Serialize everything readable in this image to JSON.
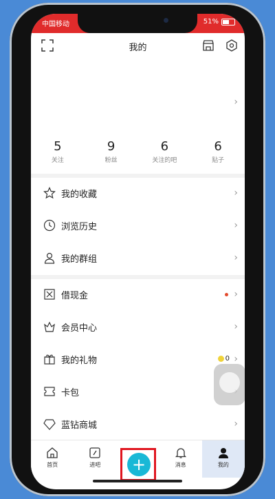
{
  "status": {
    "carrier": "中国移动",
    "battery": "51%"
  },
  "header": {
    "title": "我的"
  },
  "stats": [
    {
      "num": "5",
      "label": "关注"
    },
    {
      "num": "9",
      "label": "粉丝"
    },
    {
      "num": "6",
      "label": "关注的吧"
    },
    {
      "num": "6",
      "label": "贴子"
    }
  ],
  "menu1": [
    {
      "label": "我的收藏"
    },
    {
      "label": "浏览历史"
    },
    {
      "label": "我的群组"
    }
  ],
  "menu2": [
    {
      "label": "借现金"
    },
    {
      "label": "会员中心"
    },
    {
      "label": "我的礼物",
      "badge": "0"
    },
    {
      "label": "卡包"
    },
    {
      "label": "蓝钻商城"
    }
  ],
  "tabs": [
    {
      "label": "首页"
    },
    {
      "label": "进吧"
    },
    {
      "label": ""
    },
    {
      "label": "消息"
    },
    {
      "label": "我的"
    }
  ],
  "colors": {
    "status_bar": "#e02b2b",
    "accent_plus": "#19b8d6",
    "highlight_border": "#e0141e"
  }
}
